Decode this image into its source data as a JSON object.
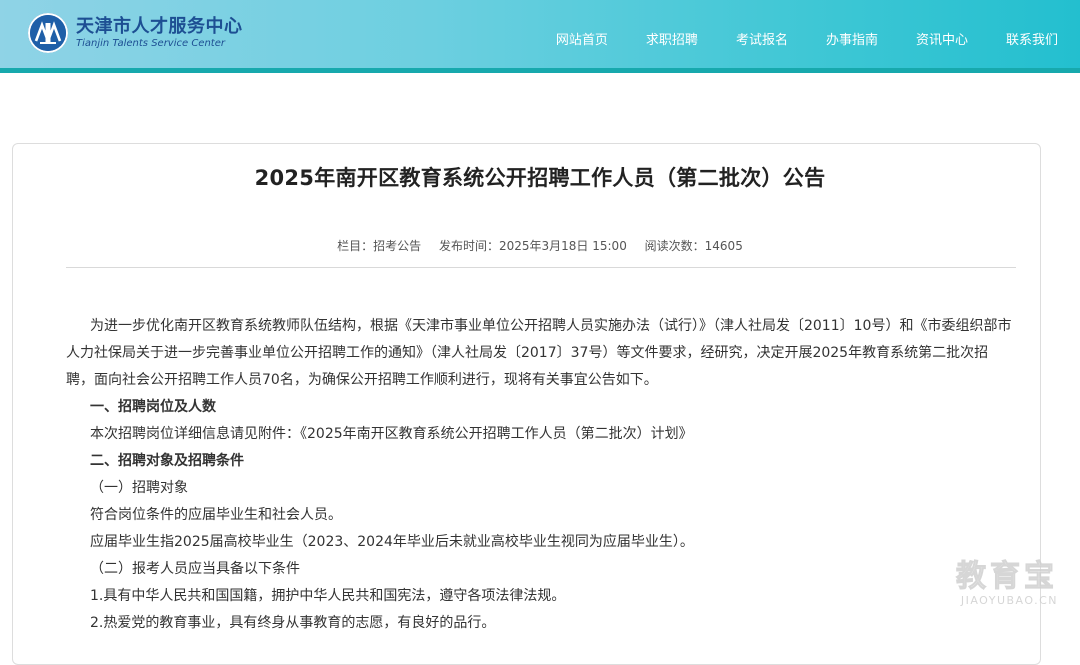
{
  "header": {
    "logo_cn": "天津市人才服务中心",
    "logo_en": "Tianjin Talents Service Center",
    "nav": [
      "网站首页",
      "求职招聘",
      "考试报名",
      "办事指南",
      "资讯中心",
      "联系我们"
    ]
  },
  "article": {
    "title": "2025年南开区教育系统公开招聘工作人员（第二批次）公告",
    "meta": {
      "column": "栏目：招考公告",
      "publish_time": "发布时间：2025年3月18日 15:00",
      "views": "阅读次数：14605"
    },
    "paragraphs": [
      "为进一步优化南开区教育系统教师队伍结构，根据《天津市事业单位公开招聘人员实施办法（试行）》（津人社局发〔2011〕10号）和《市委组织部市人力社保局关于进一步完善事业单位公开招聘工作的通知》（津人社局发〔2017〕37号）等文件要求，经研究，决定开展2025年教育系统第二批次招聘，面向社会公开招聘工作人员70名，为确保公开招聘工作顺利进行，现将有关事宜公告如下。",
      "一、招聘岗位及人数",
      "本次招聘岗位详细信息请见附件：《2025年南开区教育系统公开招聘工作人员（第二批次）计划》",
      "二、招聘对象及招聘条件",
      "（一）招聘对象",
      "符合岗位条件的应届毕业生和社会人员。",
      "应届毕业生指2025届高校毕业生（2023、2024年毕业后未就业高校毕业生视同为应届毕业生）。",
      "（二）报考人员应当具备以下条件",
      "1.具有中华人民共和国国籍，拥护中华人民共和国宪法，遵守各项法律法规。",
      "2.热爱党的教育事业，具有终身从事教育的志愿，有良好的品行。"
    ]
  },
  "watermark": {
    "cn": "教育宝",
    "en": "JIAOYUBAO.CN"
  },
  "colors": {
    "header_start": "#8fd3e6",
    "header_end": "#23bfcf",
    "header_bar": "#17a9ad",
    "logo_blue": "#1d4f93"
  }
}
